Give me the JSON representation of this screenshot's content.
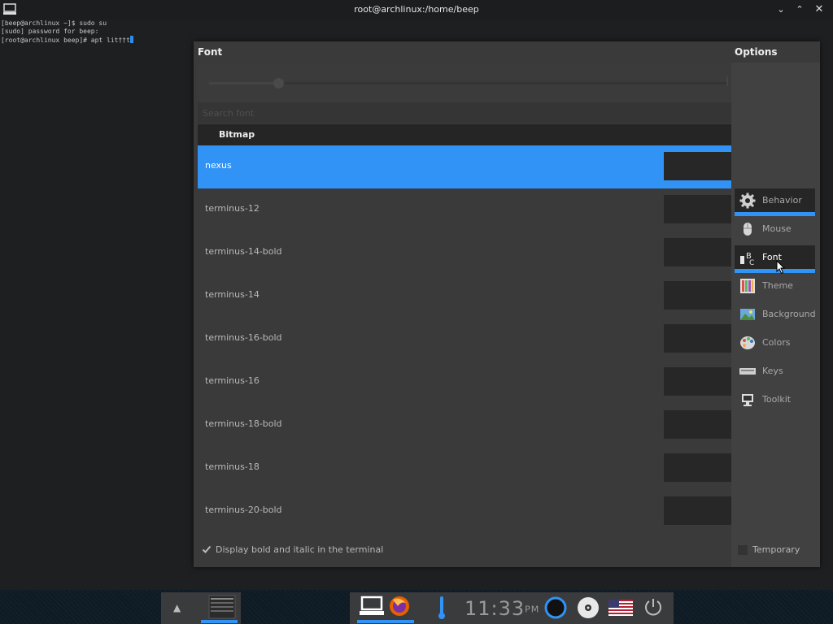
{
  "window": {
    "title": "root@archlinux:/home/beep"
  },
  "terminal": {
    "lines": [
      "[beep@archlinux ~]$ sudo su",
      "[sudo] password for beep:",
      "[root@archlinux beep]# apt lit††t"
    ]
  },
  "dialog": {
    "font_header": "Font",
    "options_header": "Options",
    "search_placeholder": "Search font",
    "group_header": "Bitmap",
    "fonts": [
      "nexus",
      "terminus-12",
      "terminus-14-bold",
      "terminus-14",
      "terminus-16-bold",
      "terminus-16",
      "terminus-18-bold",
      "terminus-18",
      "terminus-20-bold"
    ],
    "selected_font": "nexus",
    "bold_italic_label": "Display bold and italic in the terminal",
    "bold_italic_checked": true,
    "temporary_label": "Temporary",
    "temporary_checked": false,
    "options": [
      {
        "label": "Behavior",
        "icon": "gear-icon"
      },
      {
        "label": "Mouse",
        "icon": "mouse-icon"
      },
      {
        "label": "Font",
        "icon": "font-icon"
      },
      {
        "label": "Theme",
        "icon": "theme-icon"
      },
      {
        "label": "Background",
        "icon": "background-icon"
      },
      {
        "label": "Colors",
        "icon": "palette-icon"
      },
      {
        "label": "Keys",
        "icon": "keyboard-icon"
      },
      {
        "label": "Toolkit",
        "icon": "toolkit-icon"
      }
    ],
    "active_option": "Font"
  },
  "taskbar": {
    "clock": {
      "time": "11:33",
      "ampm": "PM"
    }
  },
  "colors": {
    "accent": "#3193f5",
    "dialog_bg": "#3a3a3a",
    "desktop_bg": "#1e1f21"
  }
}
